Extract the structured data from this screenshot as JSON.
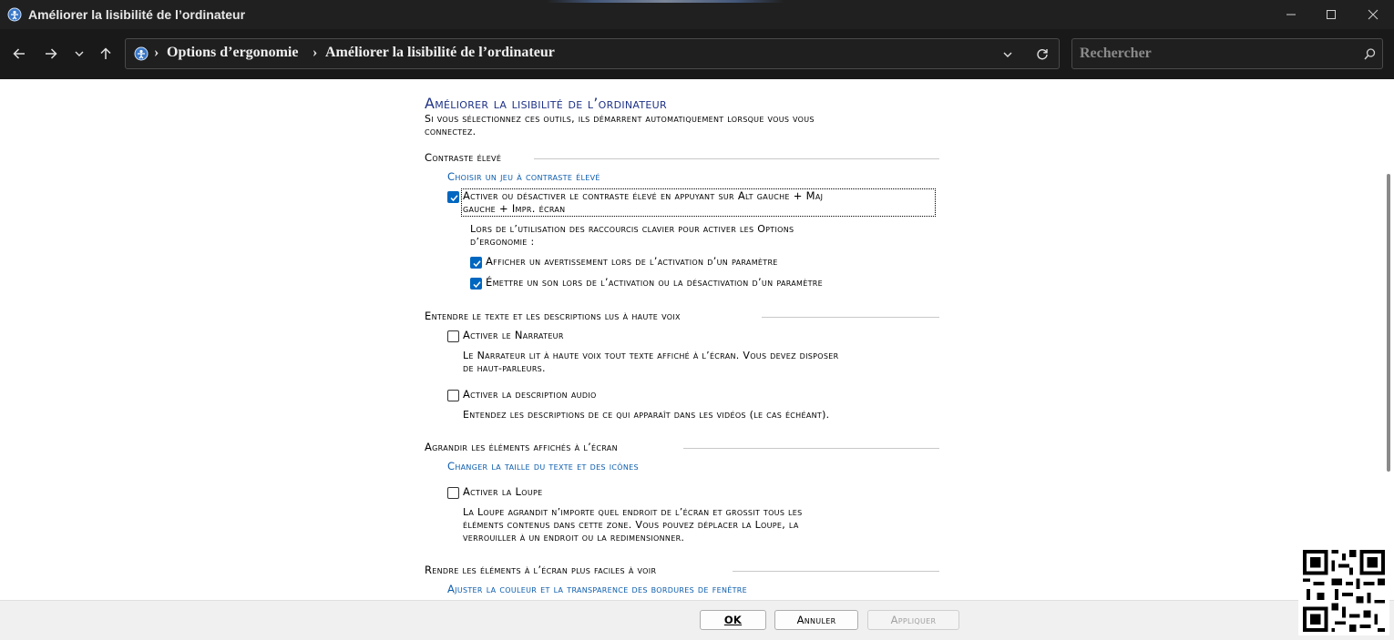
{
  "window": {
    "title": "Améliorer la lisibilité de l’ordinateur"
  },
  "nav": {
    "breadcrumb": [
      "Options d’ergonomie",
      "Améliorer la lisibilité de l’ordinateur"
    ],
    "search_placeholder": "Rechercher"
  },
  "page": {
    "title": "Améliorer la lisibilité de l’ordinateur",
    "subtitle_line1": "Si vous sélectionnez ces outils, ils démarrent automatiquement lorsque vous vous",
    "subtitle_line2": "connectez."
  },
  "sections": {
    "contrast": {
      "heading": "Contraste élevé",
      "link": "Choisir un jeu à contraste élevé",
      "toggle_line1": "Activer ou désactiver le contraste élevé en appuyant sur Alt gauche + Maj",
      "toggle_line2": "gauche + Impr. écran",
      "toggle_checked": true,
      "shortcut_note_line1": "Lors de l’utilisation des raccourcis clavier pour activer les Options",
      "shortcut_note_line2": "d’ergonomie :",
      "warning_option": "Afficher un avertissement lors de l’activation d’un paramètre",
      "warning_checked": true,
      "sound_option": "Émettre un son lors de l’activation ou la désactivation d’un paramètre",
      "sound_checked": true
    },
    "narrator": {
      "heading": "Entendre le texte et les descriptions lus à haute voix",
      "narrator_option": "Activer le Narrateur",
      "narrator_checked": false,
      "narrator_desc_line1": "Le Narrateur lit à haute voix tout texte affiché à l’écran. Vous devez disposer",
      "narrator_desc_line2": "de haut-parleurs.",
      "audio_option": "Activer la description audio",
      "audio_checked": false,
      "audio_desc": "Entendez les descriptions de ce qui apparaît dans les vidéos (le cas échéant)."
    },
    "magnify": {
      "heading": "Agrandir les éléments affichés à l’écran",
      "link": "Changer la taille du texte et des icônes",
      "magnifier_option": "Activer la Loupe",
      "magnifier_checked": false,
      "magnifier_desc_line1": "La Loupe agrandit n’importe quel endroit de l’écran et grossit tous les",
      "magnifier_desc_line2": "éléments contenus dans cette zone. Vous pouvez déplacer la Loupe, la",
      "magnifier_desc_line3": "verrouiller à un endroit ou la redimensionner."
    },
    "easier": {
      "heading": "Rendre les éléments à l’écran plus faciles à voir",
      "link": "Ajuster la couleur et la transparence des bordures de fenêtre"
    }
  },
  "footer": {
    "ok": "OK",
    "cancel": "Annuler",
    "apply": "Appliquer"
  },
  "colors": {
    "title_blue": "#1e3287",
    "link_blue": "#0b5cad",
    "checkbox_blue": "#0067c0",
    "titlebar_bg": "#202020",
    "navbar_bg": "#191919"
  },
  "icons": [
    "control-panel-icon",
    "minimize-icon",
    "maximize-icon",
    "close-icon",
    "back-arrow-icon",
    "forward-arrow-icon",
    "chevron-down-icon",
    "up-arrow-icon",
    "refresh-icon",
    "search-icon",
    "checkmark-icon",
    "qr-code-icon"
  ]
}
